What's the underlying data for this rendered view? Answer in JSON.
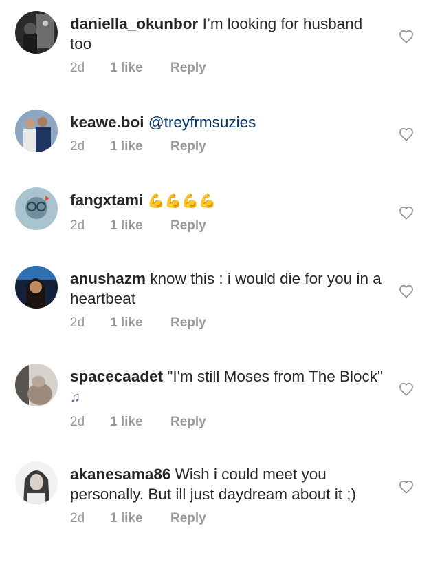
{
  "comments": [
    {
      "username": "daniella_okunbor",
      "text": "I’m looking for husband too",
      "mention": "",
      "emoji": "",
      "time": "2d",
      "likes": "1 like",
      "reply": "Reply",
      "avatar_color": "#3a3a3a"
    },
    {
      "username": "keawe.boi",
      "text": "",
      "mention": "@treyfrmsuzies",
      "emoji": "",
      "time": "2d",
      "likes": "1 like",
      "reply": "Reply",
      "avatar_color": "#4a6a9a"
    },
    {
      "username": "fangxtami",
      "text": "",
      "mention": "",
      "emoji": "💪💪💪💪",
      "time": "2d",
      "likes": "1 like",
      "reply": "Reply",
      "avatar_color": "#9fb8c4"
    },
    {
      "username": "anushazm",
      "text": "know this : i would die for you in a heartbeat",
      "mention": "",
      "emoji": "",
      "time": "2d",
      "likes": "1 like",
      "reply": "Reply",
      "avatar_color": "#1f2f4a"
    },
    {
      "username": "spacecaadet",
      "text": "\"I'm still Moses from The Block\"",
      "mention": "",
      "emoji": "♫",
      "time": "2d",
      "likes": "1 like",
      "reply": "Reply",
      "avatar_color": "#c9c0b8"
    },
    {
      "username": "akanesama86",
      "text": "Wish i could meet you personally. But ill just daydream about it ;)",
      "mention": "",
      "emoji": "",
      "time": "2d",
      "likes": "1 like",
      "reply": "Reply",
      "avatar_color": "#8a8a8a"
    }
  ],
  "icons": {
    "like": "heart-outline-icon"
  },
  "colors": {
    "text": "#262626",
    "meta": "#999999",
    "mention": "#003569"
  }
}
